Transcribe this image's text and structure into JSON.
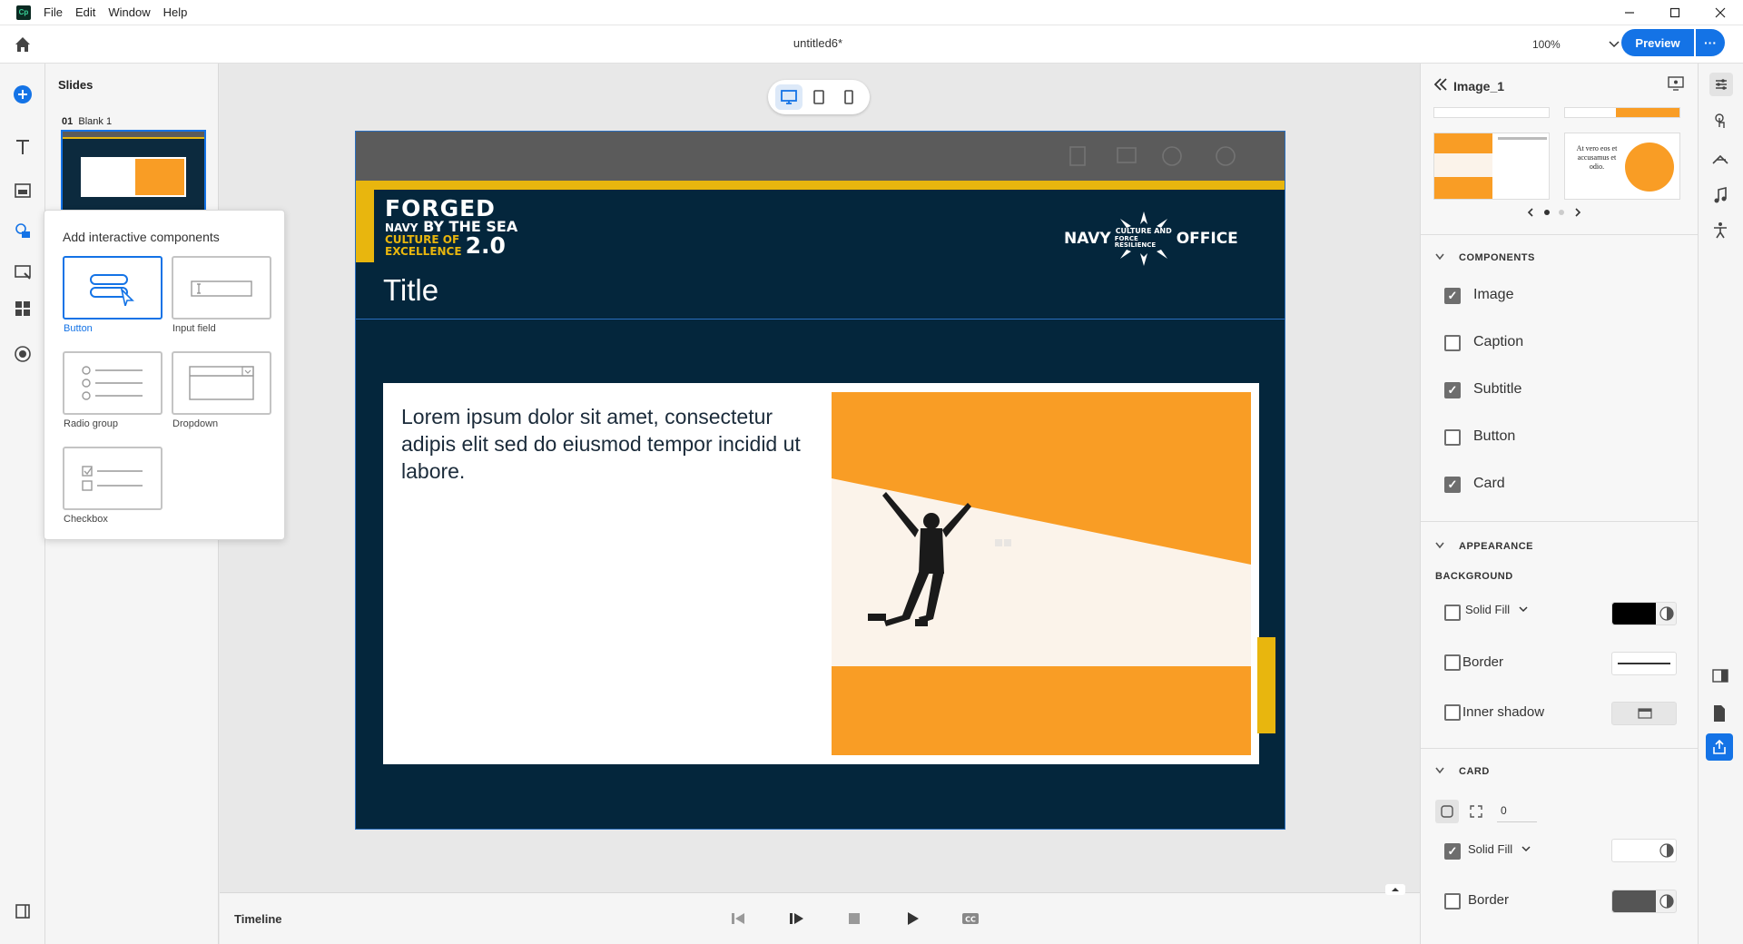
{
  "app": {
    "logo_text": "Cp",
    "menu": [
      "File",
      "Edit",
      "Window",
      "Help"
    ],
    "doc_title": "untitled6*",
    "zoom": "100%",
    "preview_label": "Preview",
    "more_label": "···"
  },
  "slides_panel": {
    "title": "Slides",
    "slide_number": "01",
    "slide_name": "Blank 1"
  },
  "popup": {
    "title": "Add interactive components",
    "items": [
      "Button",
      "Input field",
      "Radio group",
      "Dropdown",
      "Checkbox"
    ]
  },
  "slide": {
    "forged_logo": {
      "line1": "FORGED",
      "line2a": "NAVY",
      "line2b": "BY THE SEA",
      "line3a": "CULTURE OF",
      "line3b": "EXCELLENCE",
      "version": "2.0"
    },
    "navy_logo": {
      "left": "NAVY",
      "center1": "CULTURE AND",
      "center2": "FORCE RESILIENCE",
      "right": "OFFICE"
    },
    "title": "Title",
    "body": "Lorem ipsum dolor sit amet, consectetur adipis elit sed do eiusmod tempor incidid ut labore."
  },
  "timeline": {
    "label": "Timeline"
  },
  "properties": {
    "title": "Image_1",
    "thumb_text_2": "At vero eos et accusamus et odio.",
    "components_title": "COMPONENTS",
    "components": [
      {
        "label": "Image",
        "checked": true
      },
      {
        "label": "Caption",
        "checked": false
      },
      {
        "label": "Subtitle",
        "checked": true
      },
      {
        "label": "Button",
        "checked": false
      },
      {
        "label": "Card",
        "checked": true
      }
    ],
    "appearance_title": "APPEARANCE",
    "background_title": "BACKGROUND",
    "solid_fill_label": "Solid Fill",
    "border_label": "Border",
    "inner_shadow_label": "Inner shadow",
    "card_title": "CARD",
    "card_radius": "0",
    "card_solid_fill_label": "Solid Fill",
    "card_border_label": "Border",
    "colors": {
      "accent": "#1473e6",
      "fill_black": "#000000",
      "border_gray": "#555555",
      "gold": "#e8b60e",
      "orange": "#f99d25",
      "navy": "#04263c"
    }
  }
}
